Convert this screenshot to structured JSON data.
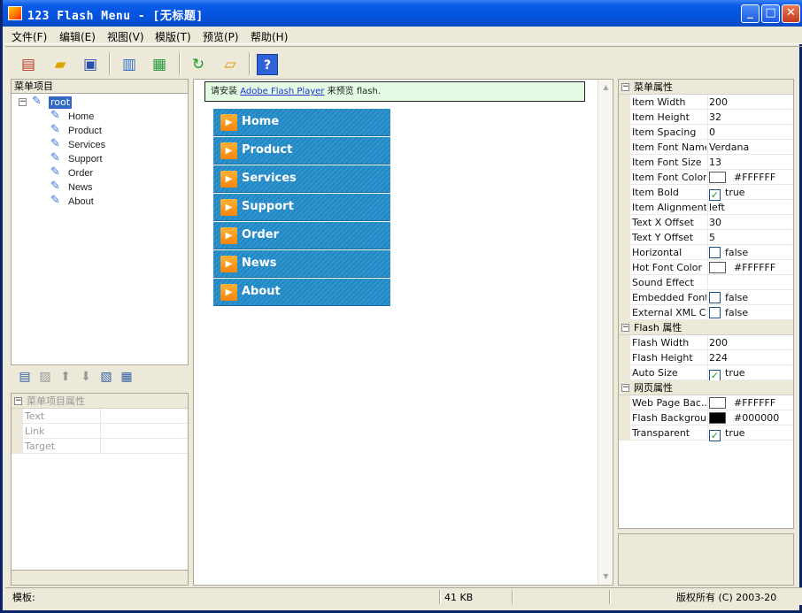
{
  "window": {
    "title": "123 Flash Menu - [无标题]",
    "minimize": "_",
    "maximize": "□",
    "close": "✕"
  },
  "menu": [
    "文件(F)",
    "编辑(E)",
    "视图(V)",
    "模版(T)",
    "预览(P)",
    "帮助(H)"
  ],
  "toolbar_icons": [
    "new-icon",
    "open-folder-icon",
    "save-icon",
    "export-icon",
    "publish-icon",
    "refresh-icon",
    "settings-folder-icon",
    "help-icon"
  ],
  "tree": {
    "header": "菜单项目",
    "root": "root",
    "items": [
      "Home",
      "Product",
      "Services",
      "Support",
      "Order",
      "News",
      "About"
    ]
  },
  "item_props": {
    "header": "菜单项目属性",
    "rows": [
      "Text",
      "Link",
      "Target"
    ]
  },
  "preview": {
    "notice_prefix": "请安装 ",
    "notice_link": "Adobe Flash Player",
    "notice_suffix": " 来预览 flash.",
    "arrow": "▶",
    "menu_items": [
      "Home",
      "Product",
      "Services",
      "Support",
      "Order",
      "News",
      "About"
    ]
  },
  "properties": {
    "menu_section": "菜单属性",
    "menu_rows": [
      {
        "name": "Item Width",
        "value": "200"
      },
      {
        "name": "Item Height",
        "value": "32"
      },
      {
        "name": "Item Spacing",
        "value": "0"
      },
      {
        "name": "Item Font Name",
        "value": "Verdana"
      },
      {
        "name": "Item Font Size",
        "value": "13"
      },
      {
        "name": "Item Font Color",
        "value": "#FFFFFF",
        "swatch": "#FFFFFF"
      },
      {
        "name": "Item Bold",
        "value": "true",
        "checked": true
      },
      {
        "name": "Item Alignment",
        "value": "left"
      },
      {
        "name": "Text X Offset",
        "value": "30"
      },
      {
        "name": "Text Y Offset",
        "value": "5"
      },
      {
        "name": "Horizontal",
        "value": "false",
        "checked": false
      },
      {
        "name": "Hot Font Color",
        "value": "#FFFFFF",
        "swatch": "#FFFFFF"
      },
      {
        "name": "Sound Effect",
        "value": ""
      },
      {
        "name": "Embedded Font",
        "value": "false",
        "checked": false
      },
      {
        "name": "External XML C...",
        "value": "false",
        "checked": false
      }
    ],
    "flash_section": "Flash 属性",
    "flash_rows": [
      {
        "name": "Flash Width",
        "value": "200"
      },
      {
        "name": "Flash Height",
        "value": "224"
      },
      {
        "name": "Auto Size",
        "value": "true",
        "checked": true
      }
    ],
    "page_section": "网页属性",
    "page_rows": [
      {
        "name": "Web Page Bac...",
        "value": "#FFFFFF",
        "swatch": "#FFFFFF"
      },
      {
        "name": "Flash Backgrou...",
        "value": "#000000",
        "swatch": "#000000"
      },
      {
        "name": "Transparent",
        "value": "true",
        "checked": true
      }
    ]
  },
  "status": {
    "template_label": "模板:",
    "size": "41 KB",
    "copyright": "版权所有 (C) 2003-20"
  }
}
